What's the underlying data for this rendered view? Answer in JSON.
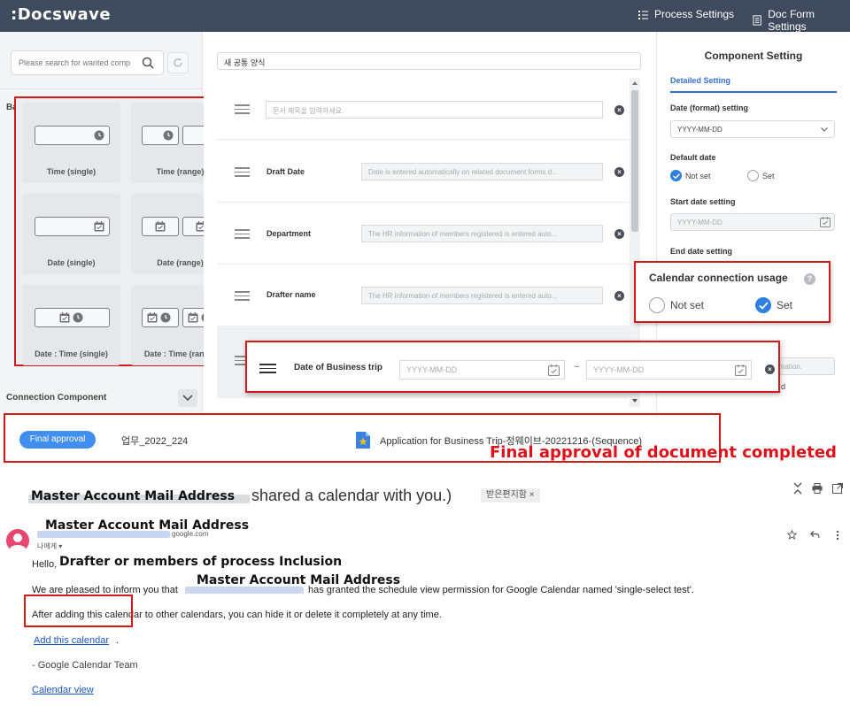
{
  "header": {
    "logo": ":Docswave",
    "process_settings": "Process Settings",
    "doc_form_settings": "Doc Form Settings"
  },
  "left_panel": {
    "search_placeholder": "Please search for wanted comp",
    "section_label": "Ba",
    "connection_component": "Connection Component",
    "palette": [
      {
        "label": "Time (single)"
      },
      {
        "label": "Time (range)"
      },
      {
        "label": "Date (single)"
      },
      {
        "label": "Date (range)"
      },
      {
        "label": "Date : Time (single)"
      },
      {
        "label": "Date : Time (range)"
      }
    ]
  },
  "form": {
    "title_value": "새 공통 양식",
    "rows": [
      {
        "label": "",
        "placeholder": "문서 제목을 입력하세요."
      },
      {
        "label": "Draft Date",
        "placeholder": "Date is entered automatically on related document forms d..."
      },
      {
        "label": "Department",
        "placeholder": "The HR information of members registered is entered auto..."
      },
      {
        "label": "Drafter name",
        "placeholder": "The HR information of members registered is entered auto..."
      }
    ]
  },
  "trip_popup": {
    "label": "Date of Business trip",
    "start_placeholder": "YYYY-MM-DD",
    "separator": "~",
    "end_placeholder": "YYYY-MM-DD"
  },
  "right_panel": {
    "title": "Component Setting",
    "tab": "Detailed Setting",
    "date_format_label": "Date (format) setting",
    "date_format_value": "YYYY-MM-DD",
    "default_date_label": "Default date",
    "default_not_set": "Not set",
    "default_set": "Set",
    "start_date_label": "Start date setting",
    "start_date_placeholder": "YYYY-MM-DD",
    "end_date_label": "End date setting",
    "partial_hint": "rmation.",
    "partial_d": "d"
  },
  "calendar_popup": {
    "title": "Calendar connection usage",
    "help": "?",
    "not_set": "Not set",
    "set": "Set",
    "selected": "set"
  },
  "final_strip": {
    "badge": "Final approval",
    "code": "업무_2022_224",
    "document": "Application for Business Trip-정웨이브-20221216-(Sequence)",
    "caption": "Final approval of document completed"
  },
  "email": {
    "subject_annotation": "Master Account Mail Address",
    "subject_rest": "shared a calendar with you.)",
    "subject_tag": "받은편지함 ×",
    "sender_annotation": "Master Account Mail Address",
    "sender_domain": "google.com",
    "to_me": "나에게 ▾",
    "hello": "Hello,",
    "hello_annotation": "Drafter or members of process Inclusion",
    "inform_annotation": "Master Account Mail Address",
    "inform_prefix": "We are pleased to inform you that",
    "inform_suffix": "has granted the schedule view permission for Google Calendar named 'single-select test'.",
    "after_adding": "After adding this calendar to other calendars, you can hide it or delete it completely at any time.",
    "add_calendar": "Add this calendar",
    "period": ".",
    "team": "- Google Calendar Team",
    "calendar_view": "Calendar view"
  },
  "colors": {
    "topbar": "#3f4a5c",
    "accent_blue": "#3a6fd8",
    "highlight_red": "#d11a1a",
    "badge_blue": "#3f8ef0"
  }
}
